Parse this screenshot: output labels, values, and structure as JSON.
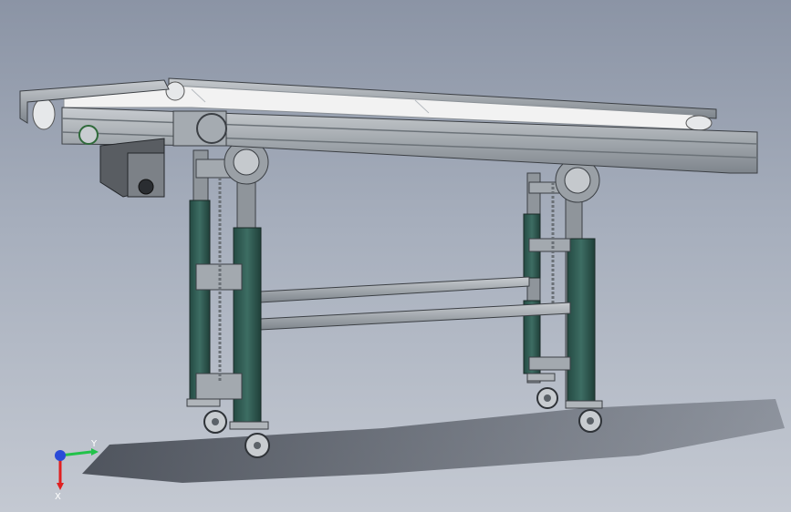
{
  "viewport": {
    "background_top": "#8b94a5",
    "background_bottom": "#c4c9d2"
  },
  "model": {
    "frame_color": "#9aa0a6",
    "leg_sleeve_color": "#2f5a52",
    "belt_color": "#f2f2f2",
    "motor_color": "#5a5a5a"
  },
  "triad": {
    "y_label": "Y",
    "x_label": "X",
    "y_color": "#22c24a",
    "x_color": "#e02020",
    "z_color": "#2a4bd8"
  }
}
